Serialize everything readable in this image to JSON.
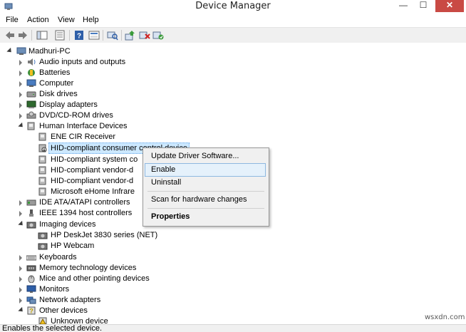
{
  "window": {
    "title": "Device Manager",
    "minimize_glyph": "—",
    "maximize_glyph": "☐",
    "close_glyph": "✕"
  },
  "menu": [
    "File",
    "Action",
    "View",
    "Help"
  ],
  "toolbar": {
    "buttons": [
      "back-icon",
      "forward-icon",
      "show-hide-console-tree-icon",
      "properties-icon",
      "help-icon",
      "console-view-icon",
      "scan-hardware-icon",
      "update-driver-icon",
      "uninstall-icon",
      "enable-icon"
    ]
  },
  "tree": {
    "root": "Madhuri-PC",
    "items": [
      {
        "label": "Audio inputs and outputs",
        "icon": "speaker-icon"
      },
      {
        "label": "Batteries",
        "icon": "battery-icon"
      },
      {
        "label": "Computer",
        "icon": "computer-icon"
      },
      {
        "label": "Disk drives",
        "icon": "disk-drive-icon"
      },
      {
        "label": "Display adapters",
        "icon": "display-adapter-icon"
      },
      {
        "label": "DVD/CD-ROM drives",
        "icon": "dvd-drive-icon"
      },
      {
        "label": "Human Interface Devices",
        "icon": "hid-icon"
      },
      {
        "label": "ENE CIR Receiver",
        "icon": "hid-device-icon"
      },
      {
        "label": "HID-compliant consumer control device",
        "icon": "hid-disabled-device-icon"
      },
      {
        "label": "HID-compliant system co",
        "icon": "hid-device-icon"
      },
      {
        "label": "HID-compliant vendor-d",
        "icon": "hid-device-icon"
      },
      {
        "label": "HID-compliant vendor-d",
        "icon": "hid-device-icon"
      },
      {
        "label": "Microsoft eHome Infrare",
        "icon": "hid-device-icon"
      },
      {
        "label": "IDE ATA/ATAPI controllers",
        "icon": "ide-controller-icon"
      },
      {
        "label": "IEEE 1394 host controllers",
        "icon": "ieee1394-icon"
      },
      {
        "label": "Imaging devices",
        "icon": "imaging-icon"
      },
      {
        "label": "HP DeskJet 3830 series (NET)",
        "icon": "camera-icon"
      },
      {
        "label": "HP Webcam",
        "icon": "camera-icon"
      },
      {
        "label": "Keyboards",
        "icon": "keyboard-icon"
      },
      {
        "label": "Memory technology devices",
        "icon": "memory-icon"
      },
      {
        "label": "Mice and other pointing devices",
        "icon": "mouse-icon"
      },
      {
        "label": "Monitors",
        "icon": "monitor-icon"
      },
      {
        "label": "Network adapters",
        "icon": "network-icon"
      },
      {
        "label": "Other devices",
        "icon": "other-devices-icon"
      },
      {
        "label": "Unknown device",
        "icon": "unknown-device-icon"
      }
    ]
  },
  "context_menu": {
    "items": [
      "Update Driver Software...",
      "Enable",
      "Uninstall",
      "Scan for hardware changes",
      "Properties"
    ],
    "highlighted": "Enable"
  },
  "status": "Enables the selected device.",
  "watermark": "wsxdn.com",
  "colors": {
    "close_button": "#c94a44",
    "selection": "#cce8ff",
    "menu_highlight": "#e5f1fb"
  }
}
